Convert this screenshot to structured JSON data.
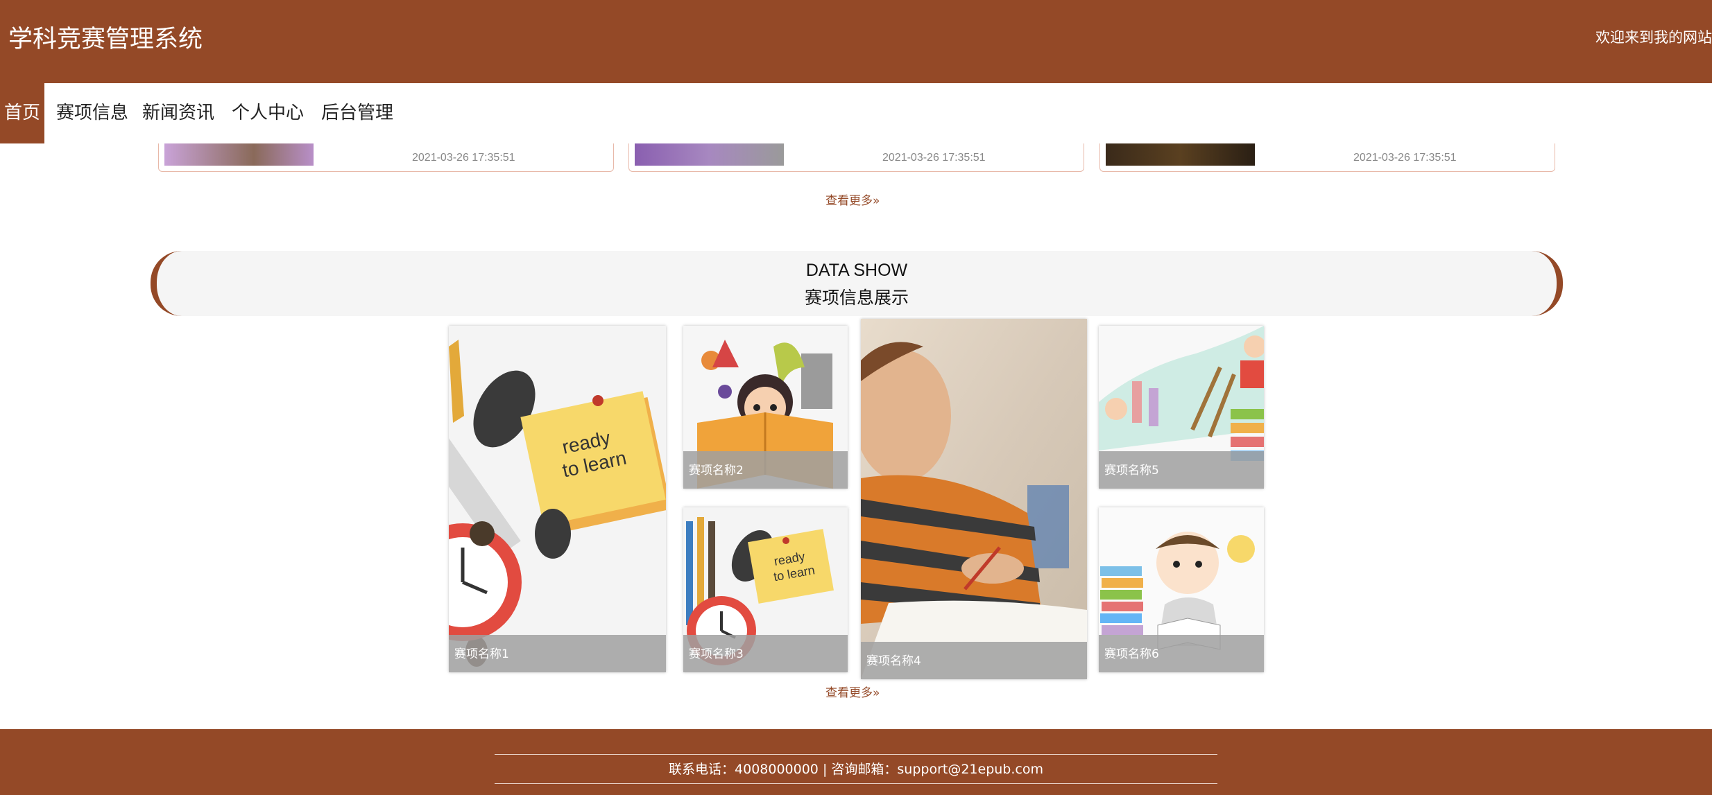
{
  "header": {
    "title": "学科竞赛管理系统",
    "welcome": "欢迎来到我的网站"
  },
  "nav": {
    "items": [
      "首页",
      "赛项信息",
      "新闻资讯",
      "个人中心",
      "后台管理"
    ]
  },
  "news": {
    "items": [
      {
        "date": "2021-03-26 17:35:51"
      },
      {
        "date": "2021-03-26 17:35:51"
      },
      {
        "date": "2021-03-26 17:35:51"
      }
    ],
    "more": "查看更多"
  },
  "showcase": {
    "title_en": "DATA SHOW",
    "title_cn": "赛项信息展示",
    "items": [
      "赛项名称1",
      "赛项名称2",
      "赛项名称3",
      "赛项名称4",
      "赛项名称5",
      "赛项名称6"
    ],
    "more": "查看更多"
  },
  "footer": {
    "contact": "联系电话：4008000000 | 咨询邮箱：support@21epub.com"
  },
  "colors": {
    "brand": "#944927",
    "accent": "#f5d56b"
  }
}
